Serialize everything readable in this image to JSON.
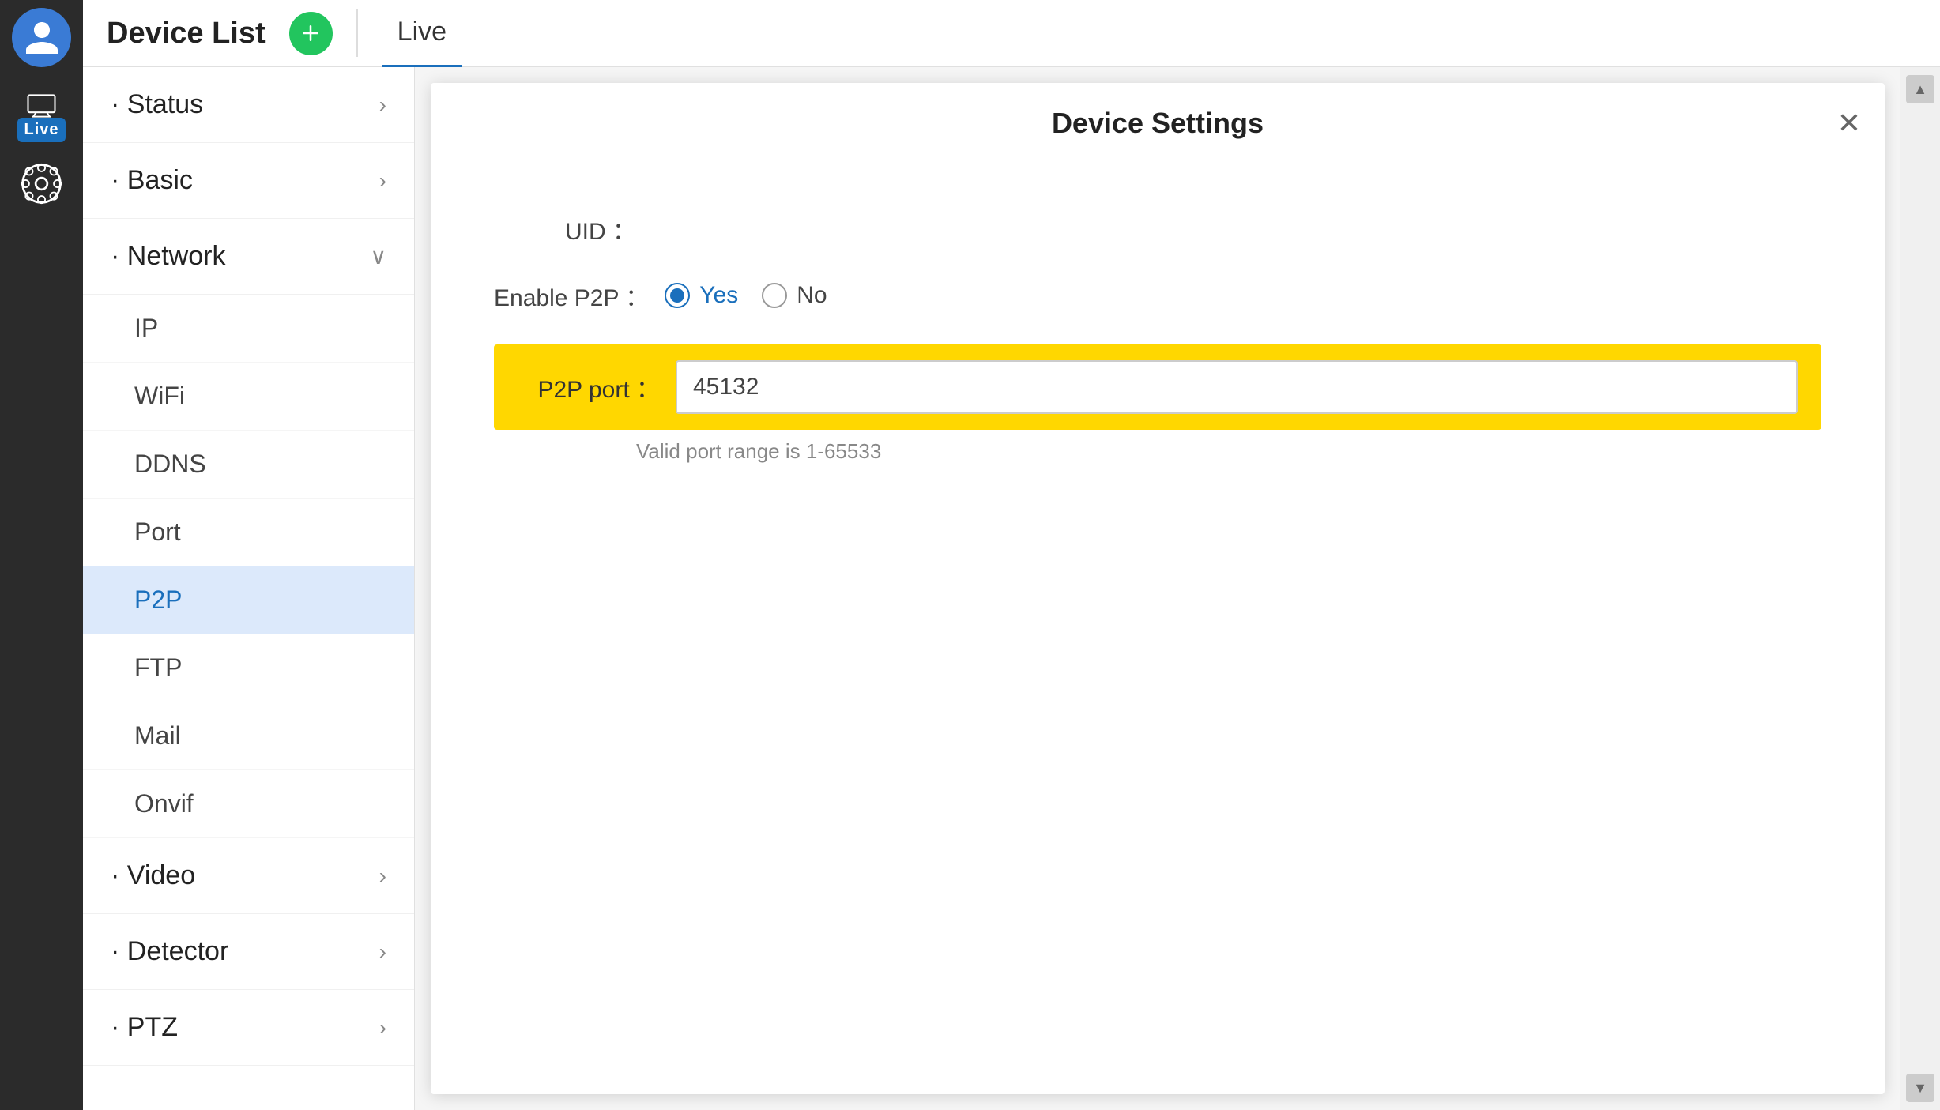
{
  "app": {
    "title": "Device List",
    "add_button_label": "+",
    "tab_live": "Live"
  },
  "dialog": {
    "title": "Device Settings",
    "close_label": "✕",
    "uid_label": "UID ：",
    "uid_value": "",
    "enable_p2p_label": "Enable P2P ：",
    "p2p_yes_label": "Yes",
    "p2p_no_label": "No",
    "p2p_port_label": "P2P port ：",
    "p2p_port_value": "45132",
    "port_hint": "Valid port range is 1-65533"
  },
  "sidebar": {
    "icons": [
      {
        "name": "avatar",
        "type": "avatar"
      },
      {
        "name": "live-tv",
        "type": "live"
      },
      {
        "name": "film-reel",
        "type": "film"
      }
    ]
  },
  "nav": {
    "items": [
      {
        "id": "status",
        "label": "· Status",
        "expandable": true,
        "expanded": false,
        "children": []
      },
      {
        "id": "basic",
        "label": "· Basic",
        "expandable": true,
        "expanded": false,
        "children": []
      },
      {
        "id": "network",
        "label": "· Network",
        "expandable": true,
        "expanded": true,
        "children": [
          {
            "id": "ip",
            "label": "IP",
            "active": false
          },
          {
            "id": "wifi",
            "label": "WiFi",
            "active": false
          },
          {
            "id": "ddns",
            "label": "DDNS",
            "active": false
          },
          {
            "id": "port",
            "label": "Port",
            "active": false
          },
          {
            "id": "p2p",
            "label": "P2P",
            "active": true
          },
          {
            "id": "ftp",
            "label": "FTP",
            "active": false
          },
          {
            "id": "mail",
            "label": "Mail",
            "active": false
          },
          {
            "id": "onvif",
            "label": "Onvif",
            "active": false
          }
        ]
      },
      {
        "id": "video",
        "label": "· Video",
        "expandable": true,
        "expanded": false,
        "children": []
      },
      {
        "id": "detector",
        "label": "· Detector",
        "expandable": true,
        "expanded": false,
        "children": []
      },
      {
        "id": "ptz",
        "label": "· PTZ",
        "expandable": true,
        "expanded": false,
        "children": []
      }
    ]
  }
}
